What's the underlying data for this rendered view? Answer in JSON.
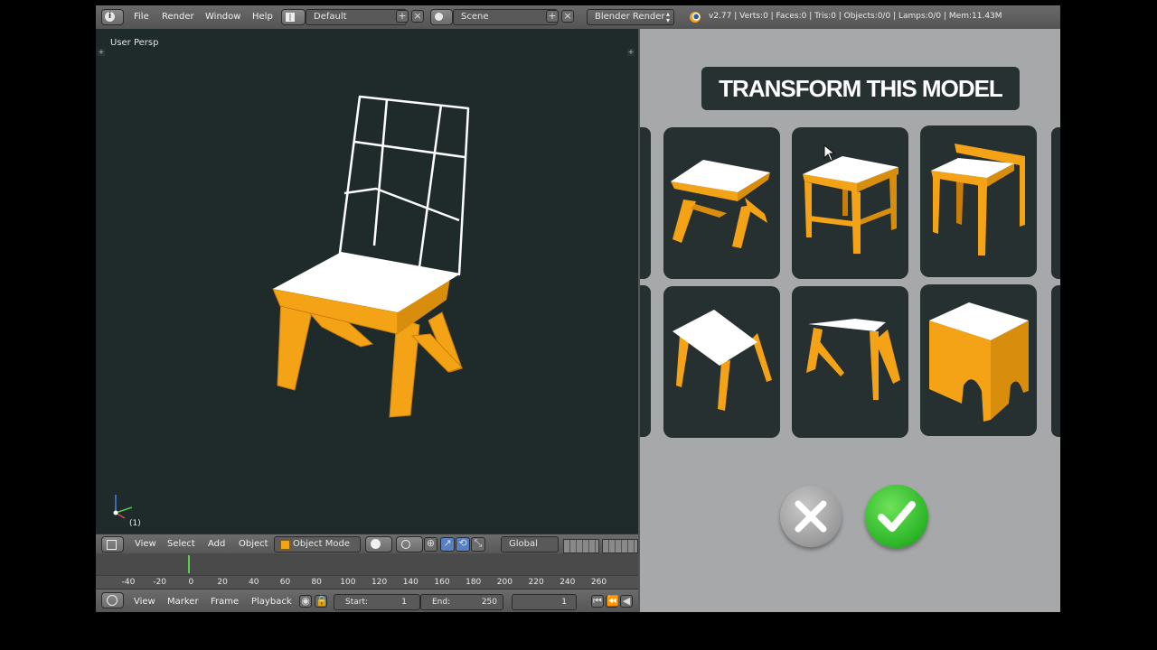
{
  "topbar": {
    "menu": [
      "File",
      "Render",
      "Window",
      "Help"
    ],
    "layout": "Default",
    "scene": "Scene",
    "engine": "Blender Render",
    "stats": "v2.77 | Verts:0 | Faces:0 | Tris:0 | Objects:0/0 | Lamps:0/0 | Mem:11.43M"
  },
  "viewport": {
    "title": "User Persp",
    "frame_label": "(1)"
  },
  "view3d_header": {
    "menu": [
      "View",
      "Select",
      "Add",
      "Object"
    ],
    "mode": "Object Mode",
    "orientation": "Global"
  },
  "timeline": {
    "ticks": [
      "-40",
      "-20",
      "0",
      "20",
      "40",
      "60",
      "80",
      "100",
      "120",
      "140",
      "160",
      "180",
      "200",
      "220",
      "240",
      "260"
    ],
    "menu": [
      "View",
      "Marker",
      "Frame",
      "Playback"
    ],
    "start_label": "Start:",
    "start_value": "1",
    "end_label": "End:",
    "end_value": "250",
    "current_frame": "1"
  },
  "panel": {
    "banner": "TRANSFORM THIS MODEL",
    "options": [
      "stool-x-legs",
      "table-braced",
      "table-panel",
      "stool-tapered",
      "stool-angled-legs",
      "stool-arched-base"
    ],
    "cancel_icon": "x-icon",
    "confirm_icon": "checkmark-icon"
  },
  "colors": {
    "accent_orange": "#f5a316",
    "viewport_bg": "#1f2a2b",
    "panel_bg": "#a6a8a9",
    "card_bg": "#263031",
    "confirm_green": "#2fb82a"
  }
}
